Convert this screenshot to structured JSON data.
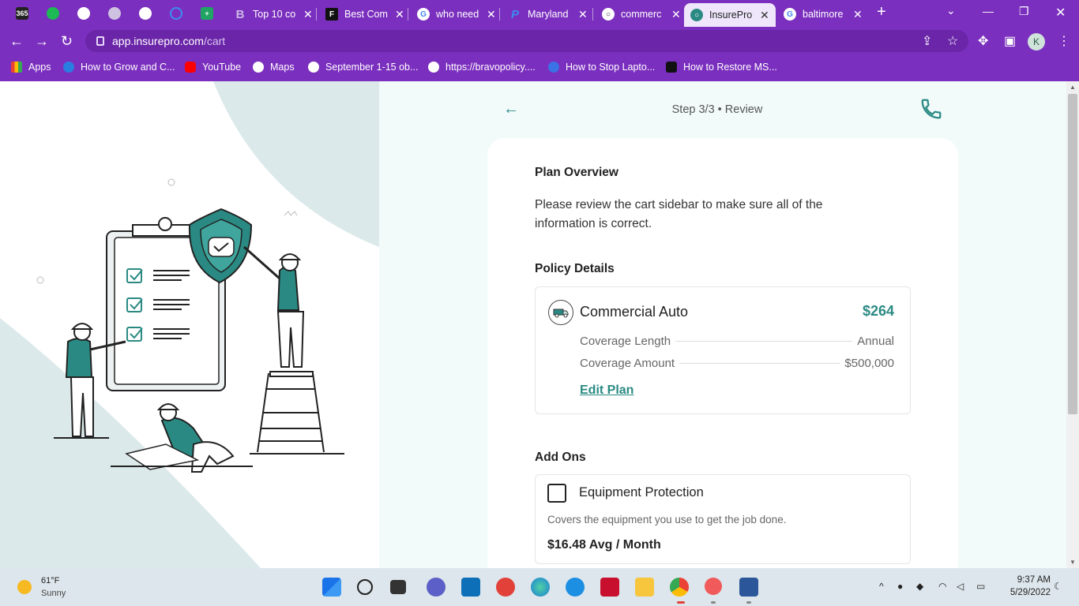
{
  "browser": {
    "tabs": [
      {
        "title": "Top 10 co",
        "fav": "B"
      },
      {
        "title": "Best Com",
        "fav": "F"
      },
      {
        "title": "who need",
        "fav": "G"
      },
      {
        "title": "Maryland",
        "fav": "P"
      },
      {
        "title": "commerc",
        "fav": "○"
      },
      {
        "title": "InsurePro",
        "fav": "○"
      },
      {
        "title": "baltimore",
        "fav": "G"
      }
    ],
    "pinned_tab_1": "365",
    "new_tab": "+",
    "url_host": "app.insurepro.com",
    "url_path": "/cart",
    "profile_initial": "K",
    "bookmarks": [
      {
        "label": "Apps"
      },
      {
        "label": "How to Grow and C..."
      },
      {
        "label": "YouTube"
      },
      {
        "label": "Maps"
      },
      {
        "label": "September 1-15 ob..."
      },
      {
        "label": "https://bravopolicy...."
      },
      {
        "label": "How to Stop Lapto..."
      },
      {
        "label": "How to Restore MS..."
      }
    ]
  },
  "header": {
    "back": "←",
    "step": "Step 3/3 • Review"
  },
  "plan_overview": {
    "heading": "Plan Overview",
    "description": "Please review the cart sidebar to make sure all of the information is correct."
  },
  "policy": {
    "heading": "Policy Details",
    "name": "Commercial Auto",
    "price": "$264",
    "rows": [
      {
        "label": "Coverage Length",
        "value": "Annual"
      },
      {
        "label": "Coverage Amount",
        "value": "$500,000"
      }
    ],
    "edit_label": "Edit Plan"
  },
  "addons": {
    "heading": "Add Ons",
    "items": [
      {
        "name": "Equipment Protection",
        "description": "Covers the equipment you use to get the job done.",
        "price": "$16.48 Avg / Month",
        "checked": false
      }
    ]
  },
  "taskbar": {
    "weather_temp": "61°F",
    "weather_cond": "Sunny",
    "time": "9:37 AM",
    "date": "5/29/2022"
  },
  "colors": {
    "browser_frame": "#7b2fbe",
    "accent": "#2a8a83",
    "panel_bg": "#f2fafa"
  }
}
